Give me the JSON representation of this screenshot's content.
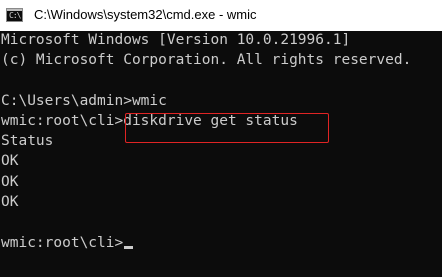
{
  "window": {
    "title": "C:\\Windows\\system32\\cmd.exe - wmic",
    "icon": "cmd-console-icon",
    "icon_glyph": "C:\\"
  },
  "console": {
    "lines": [
      "Microsoft Windows [Version 10.0.21996.1]",
      "(c) Microsoft Corporation. All rights reserved.",
      "",
      "C:\\Users\\admin>wmic",
      "wmic:root\\cli>diskdrive get status",
      "Status",
      "OK",
      "OK",
      "OK",
      "",
      "wmic:root\\cli>"
    ],
    "colors": {
      "background": "#0c0c0c",
      "text": "#cccccc",
      "highlight_box": "#e02424"
    }
  }
}
